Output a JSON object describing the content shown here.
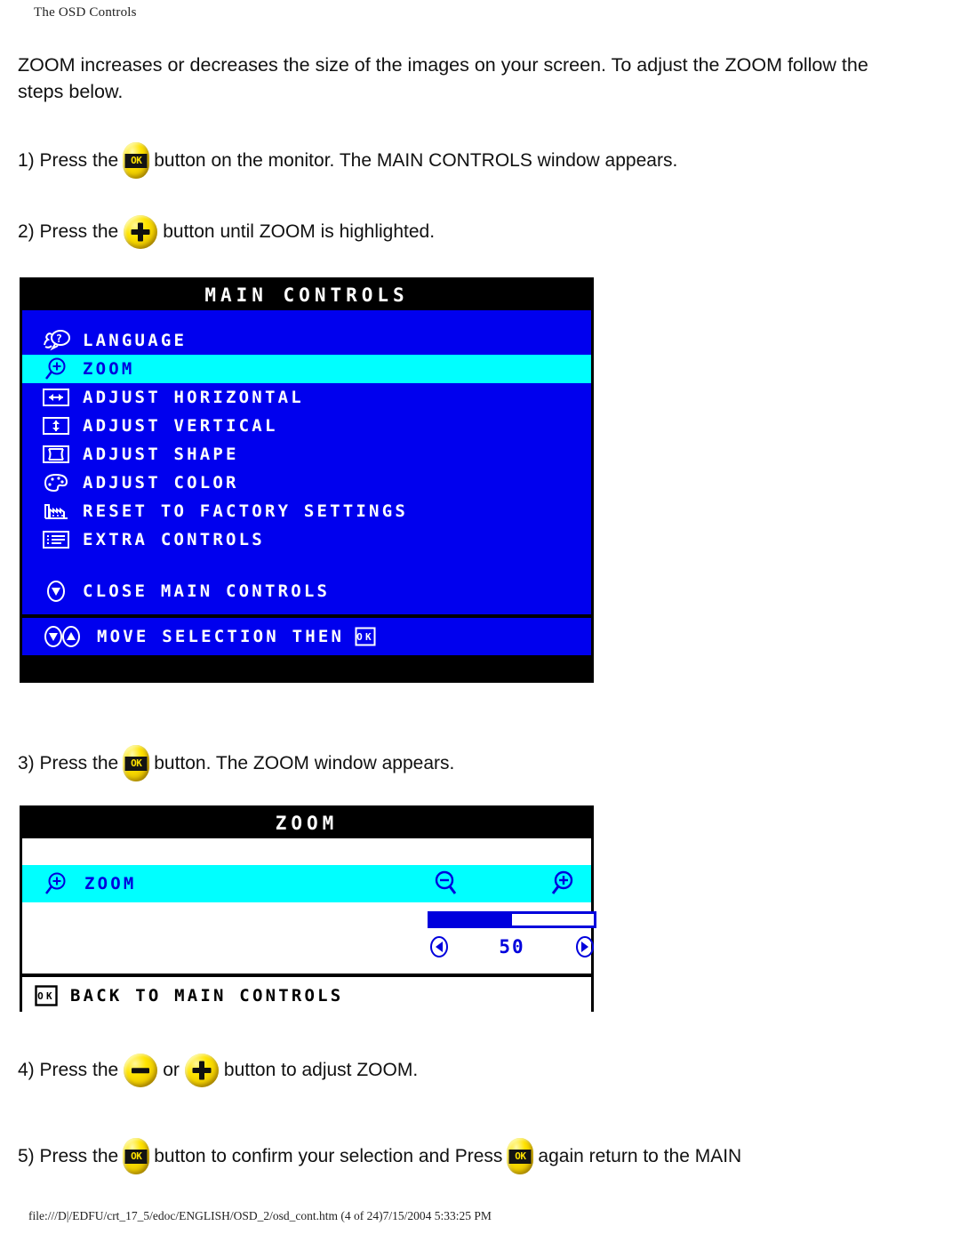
{
  "header": {
    "title": "The OSD Controls"
  },
  "intro": "ZOOM increases or decreases the size of the images on your screen. To adjust the ZOOM follow the steps below.",
  "steps": {
    "s1_a": "1) Press the",
    "s1_b": "button on the monitor. The MAIN CONTROLS window appears.",
    "s2_a": "2) Press the",
    "s2_b": "button until ZOOM is highlighted.",
    "s3_a": "3) Press the",
    "s3_b": "button. The ZOOM window appears.",
    "s4_a": "4) Press the",
    "s4_or": "or",
    "s4_b": "button to adjust ZOOM.",
    "s5_a": "5) Press the",
    "s5_b": "button to confirm your selection and Press",
    "s5_c": "again return to the MAIN"
  },
  "buttons": {
    "ok_label": "OK",
    "ok_icon": "ok-button-icon",
    "plus_icon": "plus-button-icon",
    "minus_icon": "minus-button-icon"
  },
  "osd_main": {
    "title": "MAIN CONTROLS",
    "items": [
      {
        "label": "LANGUAGE",
        "icon": "language-icon",
        "selected": false
      },
      {
        "label": "ZOOM",
        "icon": "zoom-magnifier-plus-icon",
        "selected": true
      },
      {
        "label": "ADJUST HORIZONTAL",
        "icon": "horizontal-arrows-icon",
        "selected": false
      },
      {
        "label": "ADJUST VERTICAL",
        "icon": "vertical-arrows-icon",
        "selected": false
      },
      {
        "label": "ADJUST SHAPE",
        "icon": "shape-frame-icon",
        "selected": false
      },
      {
        "label": "ADJUST COLOR",
        "icon": "color-palette-icon",
        "selected": false
      },
      {
        "label": "RESET TO FACTORY SETTINGS",
        "icon": "factory-icon",
        "selected": false
      },
      {
        "label": "EXTRA CONTROLS",
        "icon": "list-icon",
        "selected": false
      }
    ],
    "close_item": {
      "label": "CLOSE MAIN CONTROLS",
      "icon": "down-arrow-circle-icon"
    },
    "footer": {
      "label": "MOVE SELECTION THEN",
      "icons": [
        "down-arrow-circle-icon",
        "up-arrow-circle-icon"
      ],
      "trailing_icon": "ok-badge-icon",
      "trailing_label": "OK"
    },
    "colors": {
      "background": "#0000ee",
      "highlight": "#00ffff",
      "title_bar": "#000000",
      "text": "#ffffff",
      "highlight_text": "#0000dd"
    }
  },
  "osd_zoom": {
    "title": "ZOOM",
    "row": {
      "label": "ZOOM",
      "icon": "zoom-magnifier-plus-icon"
    },
    "decrease_icon": "magnifier-minus-icon",
    "increase_icon": "magnifier-plus-icon",
    "value": "50",
    "slider_percent": 50,
    "left_arrow_icon": "left-arrow-icon",
    "right_arrow_icon": "right-arrow-icon",
    "footer": {
      "label": "BACK TO MAIN CONTROLS",
      "icon": "ok-badge-icon",
      "icon_label": "OK"
    },
    "colors": {
      "background": "#ffffff",
      "highlight": "#00ffff",
      "accent": "#0000dd",
      "title_bar": "#000000"
    }
  },
  "footer": {
    "path": "file:///D|/EDFU/crt_17_5/edoc/ENGLISH/OSD_2/osd_cont.htm (4 of 24)7/15/2004 5:33:25 PM"
  }
}
